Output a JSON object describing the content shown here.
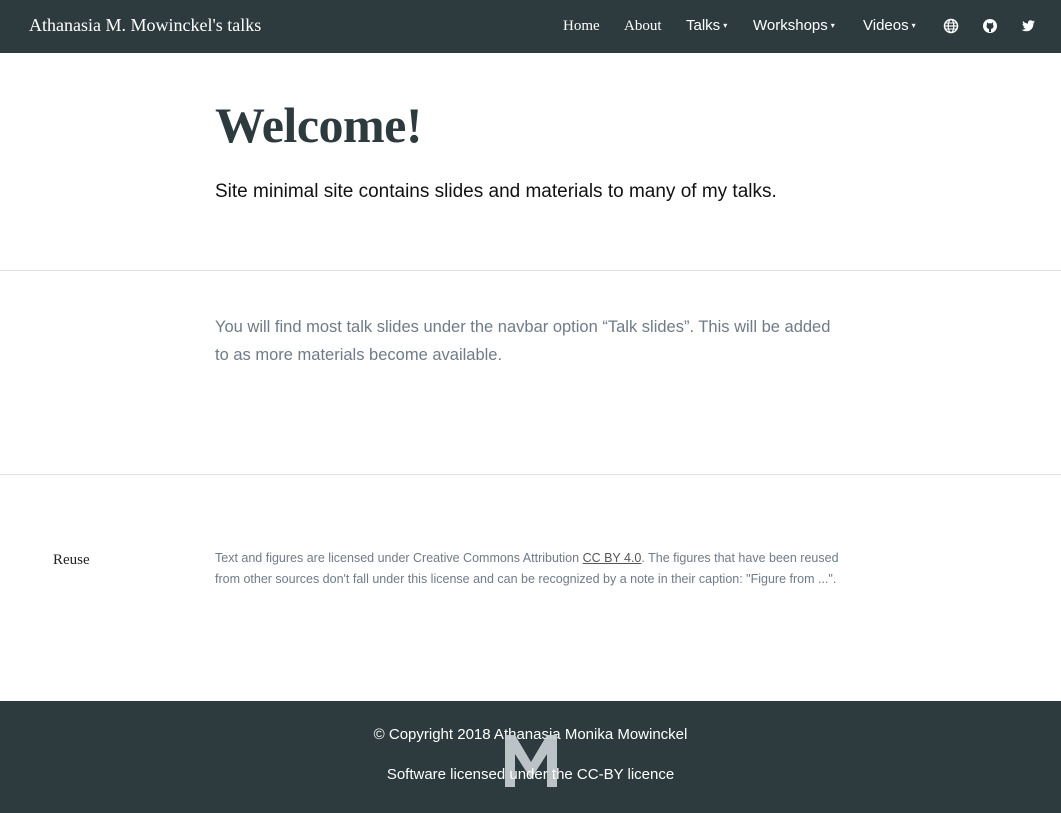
{
  "navbar": {
    "brand": "Athanasia M. Mowinckel's talks",
    "items": [
      {
        "label": "Home"
      },
      {
        "label": "About"
      },
      {
        "label": "Talks",
        "caret": "▾"
      },
      {
        "label": "Workshops",
        "caret": "▾"
      },
      {
        "label": "Videos",
        "caret": "▾"
      }
    ],
    "icons": [
      "globe-icon",
      "github-icon",
      "twitter-icon"
    ]
  },
  "main": {
    "title": "Welcome!",
    "subtitle": "Site minimal site contains slides and materials to many of my talks.",
    "body": "You will find most talk slides under the navbar option “Talk slides”. This will be added to as more materials become available."
  },
  "reuse": {
    "label": "Reuse",
    "text_before": "Text and figures are licensed under Creative Commons Attribution ",
    "link": "CC BY 4.0",
    "text_after": ". The figures that have been reused from other sources don't fall under this license and can be recognized by a note in their caption: \"Figure from ...\"."
  },
  "footer": {
    "copyright": "© Copyright 2018 Athanasia Monika Mowinckel",
    "license": "Software licensed under the CC-BY licence",
    "logo_color": "#c9cfd1"
  },
  "colors": {
    "navbar_bg": "#2e3b3e",
    "muted_text": "#6f7b88"
  }
}
